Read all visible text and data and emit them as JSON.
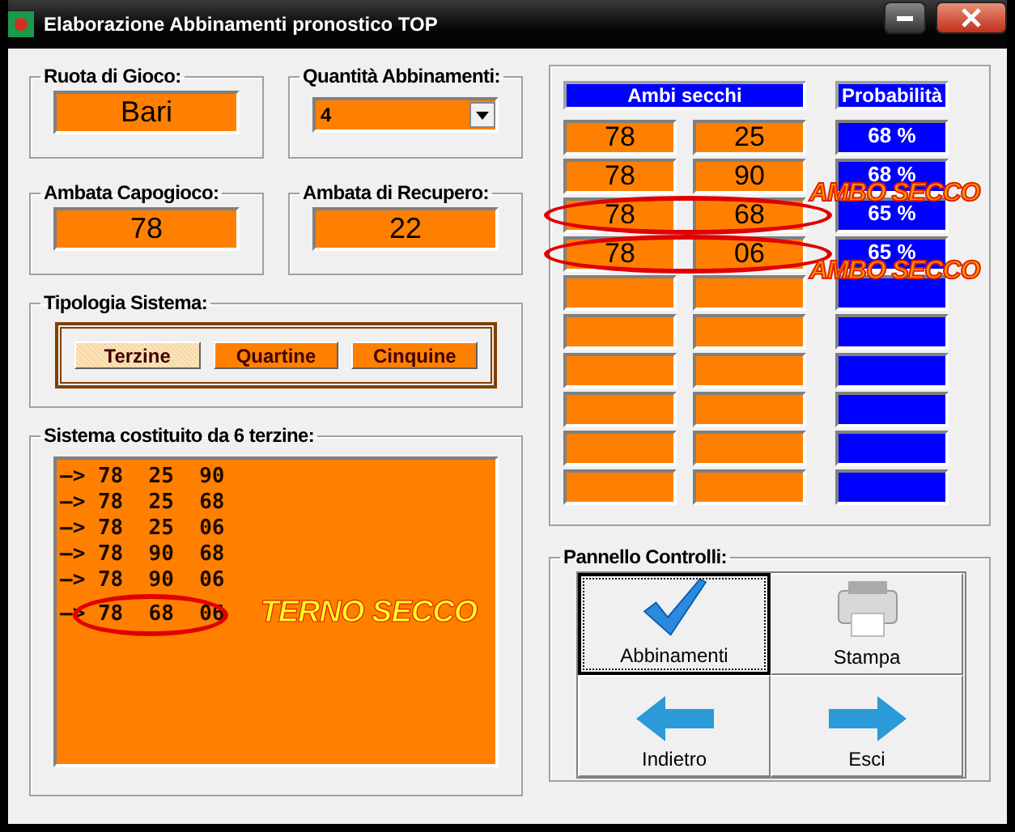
{
  "window": {
    "title": "Elaborazione Abbinamenti pronostico TOP"
  },
  "ruota": {
    "legend": "Ruota di Gioco:",
    "value": "Bari"
  },
  "quantita": {
    "legend": "Quantità Abbinamenti:",
    "value": "4"
  },
  "ambata_capogioco": {
    "legend": "Ambata Capogioco:",
    "value": "78"
  },
  "ambata_recupero": {
    "legend": "Ambata di Recupero:",
    "value": "22"
  },
  "tipologia": {
    "legend": "Tipologia Sistema:",
    "options": [
      {
        "label": "Terzine",
        "selected": true
      },
      {
        "label": "Quartine",
        "selected": false
      },
      {
        "label": "Cinquine",
        "selected": false
      }
    ]
  },
  "sistema": {
    "legend": "Sistema costituito da 6 terzine:",
    "lines": [
      {
        "text": "—> 78  25  90",
        "circled": false
      },
      {
        "text": "—> 78  25  68",
        "circled": false
      },
      {
        "text": "—> 78  25  06",
        "circled": false
      },
      {
        "text": "—> 78  90  68",
        "circled": false
      },
      {
        "text": "—> 78  90  06",
        "circled": false
      },
      {
        "text": "—> 78  68  06",
        "circled": true,
        "note": "TERNO SECCO"
      }
    ]
  },
  "ambi": {
    "header_pair": "Ambi secchi",
    "header_prob": "Probabilità",
    "rows": [
      {
        "kind": "filled",
        "a": "78",
        "b": "25",
        "prob": "68 %",
        "circled": false
      },
      {
        "kind": "filled",
        "a": "78",
        "b": "90",
        "prob": "68 %",
        "circled": false
      },
      {
        "kind": "filled",
        "a": "78",
        "b": "68",
        "prob": "65 %",
        "circled": true,
        "note": "AMBO SECCO"
      },
      {
        "kind": "filled",
        "a": "78",
        "b": "06",
        "prob": "65 %",
        "circled": true
      },
      {
        "kind": "empty",
        "note": "AMBO SECCO"
      },
      {
        "kind": "empty"
      },
      {
        "kind": "empty"
      },
      {
        "kind": "empty"
      },
      {
        "kind": "empty"
      },
      {
        "kind": "empty"
      }
    ]
  },
  "controlli": {
    "legend": "Pannello Controlli:",
    "buttons": [
      {
        "kind": "check",
        "label": "Abbinamenti",
        "focused": true
      },
      {
        "kind": "printer",
        "label": "Stampa",
        "focused": false
      },
      {
        "kind": "back",
        "label": "Indietro",
        "focused": false
      },
      {
        "kind": "forward",
        "label": "Esci",
        "focused": false
      }
    ]
  }
}
